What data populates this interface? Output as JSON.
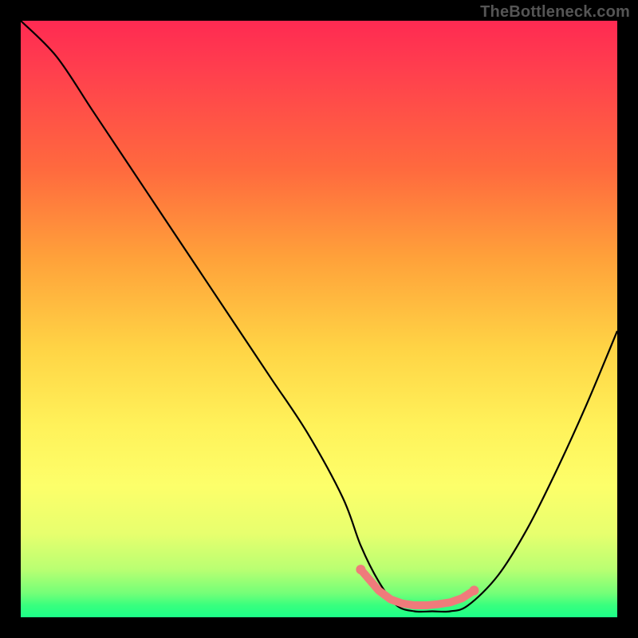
{
  "watermark": "TheBottleneck.com",
  "chart_data": {
    "type": "line",
    "title": "",
    "xlabel": "",
    "ylabel": "",
    "xlim": [
      0,
      100
    ],
    "ylim": [
      0,
      100
    ],
    "series": [
      {
        "name": "bottleneck-curve",
        "x": [
          0,
          6,
          12,
          18,
          24,
          30,
          36,
          42,
          48,
          54,
          57,
          60,
          63,
          66,
          69,
          72,
          75,
          80,
          85,
          90,
          95,
          100
        ],
        "values": [
          100,
          94,
          85,
          76,
          67,
          58,
          49,
          40,
          31,
          20,
          12,
          6,
          2,
          1,
          1,
          1,
          2,
          7,
          15,
          25,
          36,
          48
        ]
      }
    ],
    "markers": {
      "name": "highlighted-range",
      "color": "#ef7b7b",
      "points_xy": [
        [
          57,
          8
        ],
        [
          60,
          4.5
        ],
        [
          62,
          3.0
        ],
        [
          64,
          2.3
        ],
        [
          66,
          2.0
        ],
        [
          68,
          2.0
        ],
        [
          70,
          2.2
        ],
        [
          72,
          2.5
        ],
        [
          74,
          3.2
        ],
        [
          76,
          4.5
        ]
      ]
    },
    "background_gradient_stops": [
      {
        "pos": 0,
        "color": "#ff2a52"
      },
      {
        "pos": 25,
        "color": "#ff6a3e"
      },
      {
        "pos": 55,
        "color": "#ffd445"
      },
      {
        "pos": 78,
        "color": "#fdff6a"
      },
      {
        "pos": 92,
        "color": "#b9ff72"
      },
      {
        "pos": 100,
        "color": "#1cff88"
      }
    ]
  }
}
